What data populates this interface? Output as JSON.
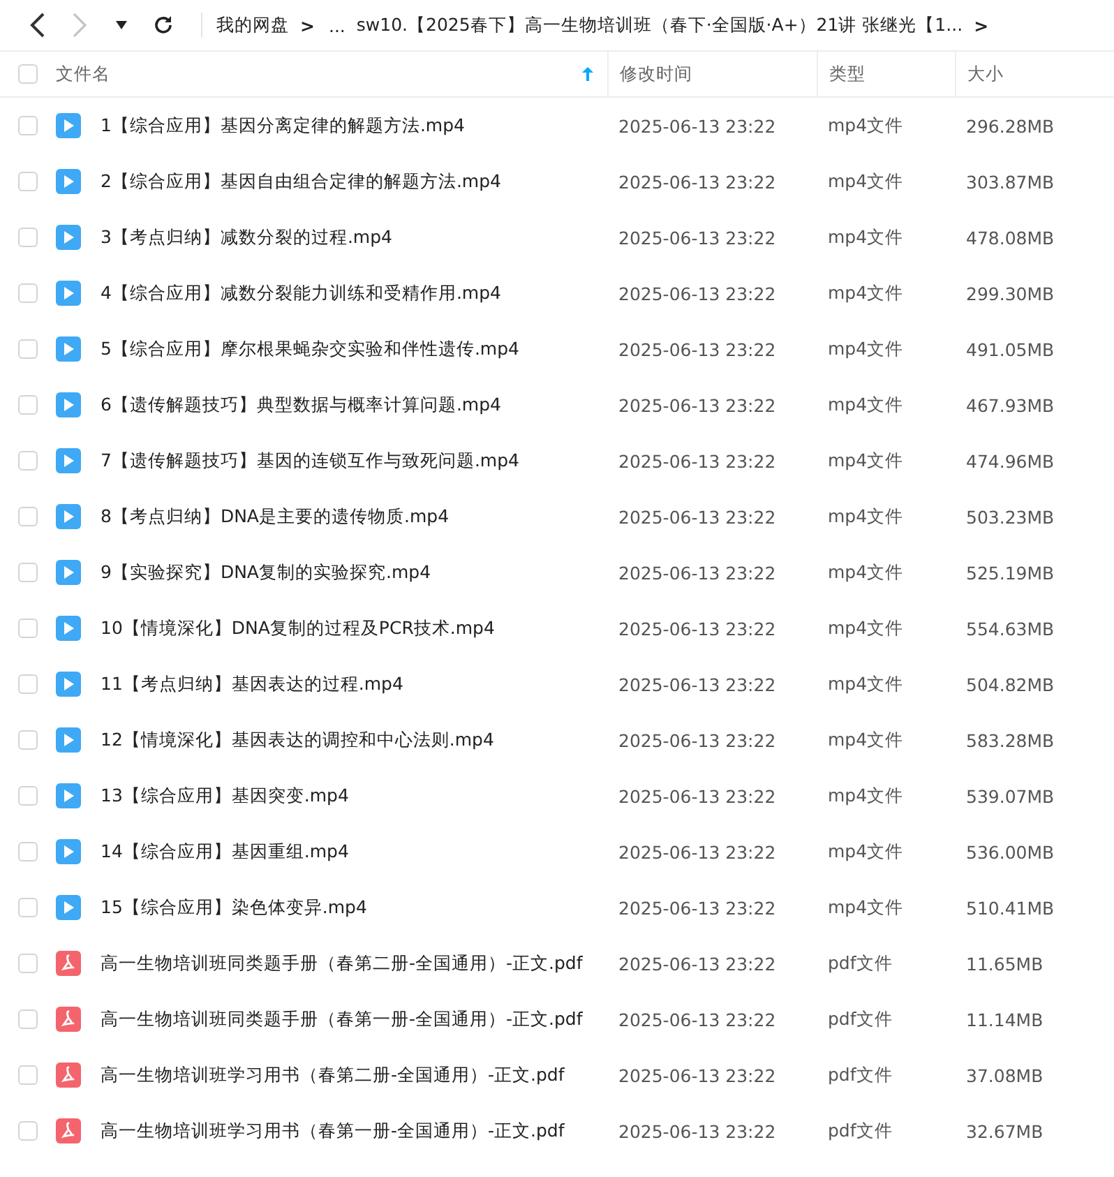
{
  "toolbar": {
    "back": {
      "disabled": false
    },
    "forward": {
      "disabled": true
    },
    "breadcrumb": [
      {
        "label": "我的网盘",
        "kind": "link"
      },
      {
        "label": ">",
        "kind": "sep"
      },
      {
        "label": "...",
        "kind": "link"
      },
      {
        "label": "sw10.【2025春下】高一生物培训班（春下·全国版·A+）21讲 张继光【1...",
        "kind": "link"
      },
      {
        "label": ">",
        "kind": "sep"
      }
    ]
  },
  "table": {
    "select_all": {
      "checked": false
    },
    "columns": [
      {
        "label": "文件名",
        "sorted": true
      },
      {
        "label": "修改时间",
        "sorted": false
      },
      {
        "label": "类型",
        "sorted": false
      },
      {
        "label": "大小",
        "sorted": false
      }
    ],
    "rows": [
      {
        "kind": "video",
        "checked": false,
        "name": "1【综合应用】基因分离定律的解题方法.mp4",
        "modified": "2025-06-13 23:22",
        "type": "mp4文件",
        "size": "296.28MB"
      },
      {
        "kind": "video",
        "checked": false,
        "name": "2【综合应用】基因自由组合定律的解题方法.mp4",
        "modified": "2025-06-13 23:22",
        "type": "mp4文件",
        "size": "303.87MB"
      },
      {
        "kind": "video",
        "checked": false,
        "name": "3【考点归纳】减数分裂的过程.mp4",
        "modified": "2025-06-13 23:22",
        "type": "mp4文件",
        "size": "478.08MB"
      },
      {
        "kind": "video",
        "checked": false,
        "name": "4【综合应用】减数分裂能力训练和受精作用.mp4",
        "modified": "2025-06-13 23:22",
        "type": "mp4文件",
        "size": "299.30MB"
      },
      {
        "kind": "video",
        "checked": false,
        "name": "5【综合应用】摩尔根果蝇杂交实验和伴性遗传.mp4",
        "modified": "2025-06-13 23:22",
        "type": "mp4文件",
        "size": "491.05MB"
      },
      {
        "kind": "video",
        "checked": false,
        "name": "6【遗传解题技巧】典型数据与概率计算问题.mp4",
        "modified": "2025-06-13 23:22",
        "type": "mp4文件",
        "size": "467.93MB"
      },
      {
        "kind": "video",
        "checked": false,
        "name": "7【遗传解题技巧】基因的连锁互作与致死问题.mp4",
        "modified": "2025-06-13 23:22",
        "type": "mp4文件",
        "size": "474.96MB"
      },
      {
        "kind": "video",
        "checked": false,
        "name": "8【考点归纳】DNA是主要的遗传物质.mp4",
        "modified": "2025-06-13 23:22",
        "type": "mp4文件",
        "size": "503.23MB"
      },
      {
        "kind": "video",
        "checked": false,
        "name": "9【实验探究】DNA复制的实验探究.mp4",
        "modified": "2025-06-13 23:22",
        "type": "mp4文件",
        "size": "525.19MB"
      },
      {
        "kind": "video",
        "checked": false,
        "name": "10【情境深化】DNA复制的过程及PCR技术.mp4",
        "modified": "2025-06-13 23:22",
        "type": "mp4文件",
        "size": "554.63MB"
      },
      {
        "kind": "video",
        "checked": false,
        "name": "11【考点归纳】基因表达的过程.mp4",
        "modified": "2025-06-13 23:22",
        "type": "mp4文件",
        "size": "504.82MB"
      },
      {
        "kind": "video",
        "checked": false,
        "name": "12【情境深化】基因表达的调控和中心法则.mp4",
        "modified": "2025-06-13 23:22",
        "type": "mp4文件",
        "size": "583.28MB"
      },
      {
        "kind": "video",
        "checked": false,
        "name": "13【综合应用】基因突变.mp4",
        "modified": "2025-06-13 23:22",
        "type": "mp4文件",
        "size": "539.07MB"
      },
      {
        "kind": "video",
        "checked": false,
        "name": "14【综合应用】基因重组.mp4",
        "modified": "2025-06-13 23:22",
        "type": "mp4文件",
        "size": "536.00MB"
      },
      {
        "kind": "video",
        "checked": false,
        "name": "15【综合应用】染色体变异.mp4",
        "modified": "2025-06-13 23:22",
        "type": "mp4文件",
        "size": "510.41MB"
      },
      {
        "kind": "pdf",
        "checked": false,
        "name": "高一生物培训班同类题手册（春第二册-全国通用）-正文.pdf",
        "modified": "2025-06-13 23:22",
        "type": "pdf文件",
        "size": "11.65MB"
      },
      {
        "kind": "pdf",
        "checked": false,
        "name": "高一生物培训班同类题手册（春第一册-全国通用）-正文.pdf",
        "modified": "2025-06-13 23:22",
        "type": "pdf文件",
        "size": "11.14MB"
      },
      {
        "kind": "pdf",
        "checked": false,
        "name": "高一生物培训班学习用书（春第二册-全国通用）-正文.pdf",
        "modified": "2025-06-13 23:22",
        "type": "pdf文件",
        "size": "37.08MB"
      },
      {
        "kind": "pdf",
        "checked": false,
        "name": "高一生物培训班学习用书（春第一册-全国通用）-正文.pdf",
        "modified": "2025-06-13 23:22",
        "type": "pdf文件",
        "size": "32.67MB"
      }
    ]
  }
}
